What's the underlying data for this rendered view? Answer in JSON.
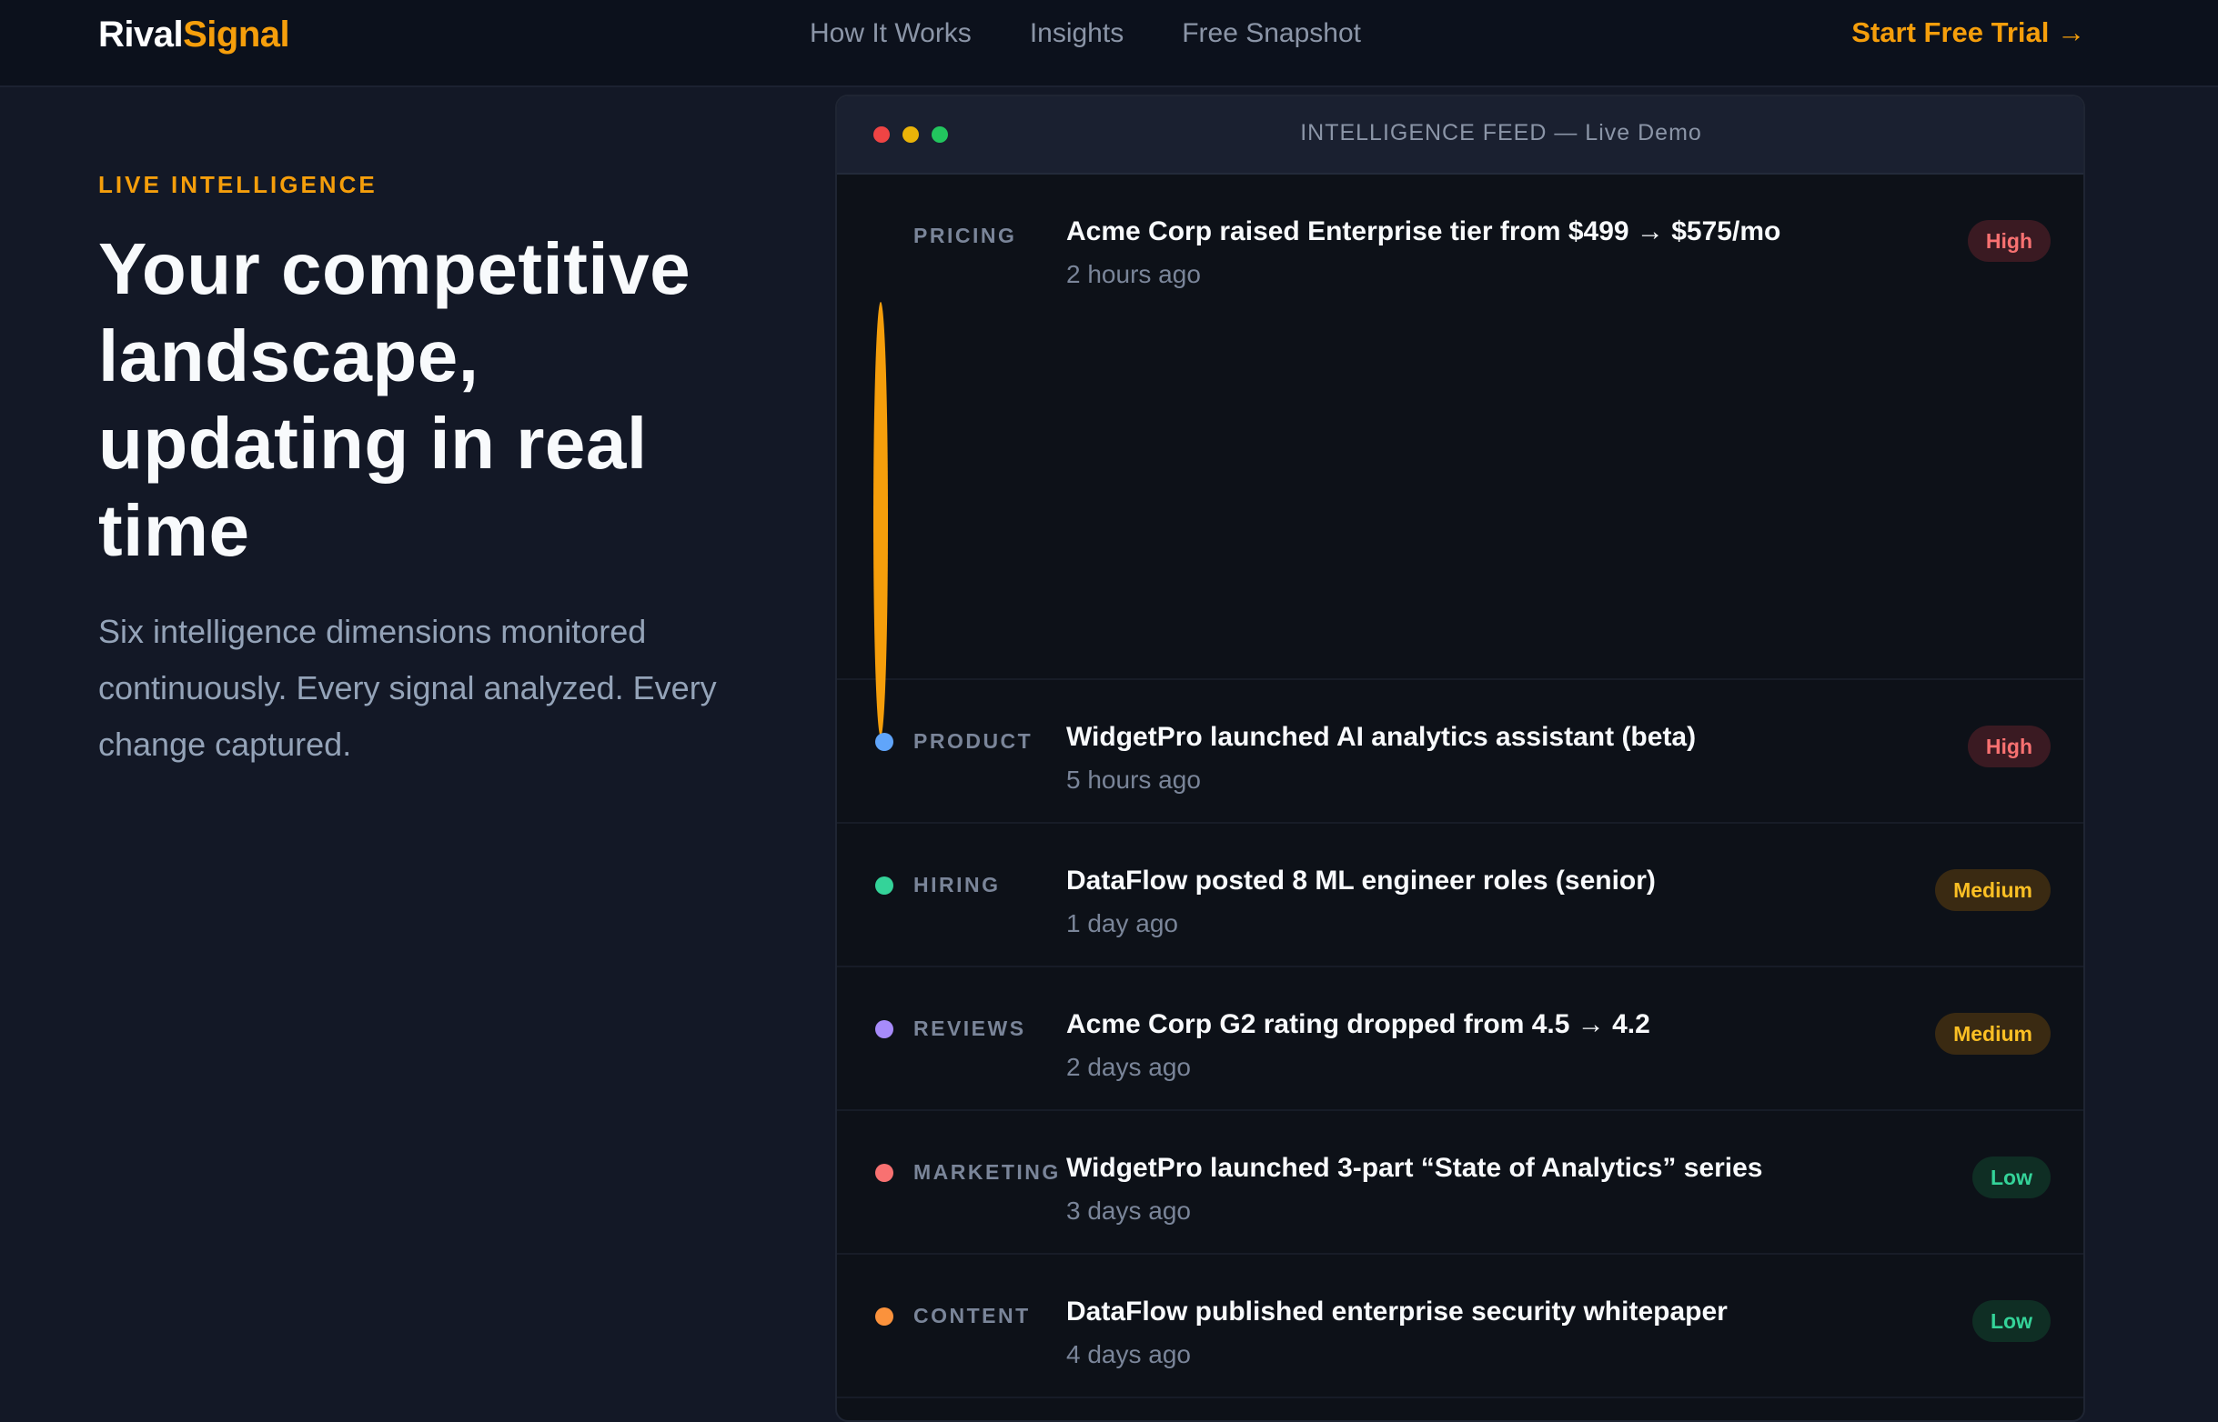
{
  "nav": {
    "logo_a": "Rival",
    "logo_b": "Signal",
    "links": [
      "How It Works",
      "Insights",
      "Free Snapshot"
    ],
    "cta": "Start Free Trial →"
  },
  "hero": {
    "eyebrow": "LIVE INTELLIGENCE",
    "title": "Your competitive landscape, updating in real time",
    "subtitle": "Six intelligence dimensions monitored continuously. Every signal analyzed. Every change captured."
  },
  "feed": {
    "title": "INTELLIGENCE FEED — Live Demo",
    "items": [
      {
        "category": "PRICING",
        "headline": "Acme Corp raised Enterprise tier from $499 → $575/mo",
        "time": "2 hours ago",
        "priority": "High",
        "color": "#f59e0b"
      },
      {
        "category": "PRODUCT",
        "headline": "WidgetPro launched AI analytics assistant (beta)",
        "time": "5 hours ago",
        "priority": "High",
        "color": "#60a5fa"
      },
      {
        "category": "HIRING",
        "headline": "DataFlow posted 8 ML engineer roles (senior)",
        "time": "1 day ago",
        "priority": "Medium",
        "color": "#34d399"
      },
      {
        "category": "REVIEWS",
        "headline": "Acme Corp G2 rating dropped from 4.5 → 4.2",
        "time": "2 days ago",
        "priority": "Medium",
        "color": "#a78bfa"
      },
      {
        "category": "MARKETING",
        "headline": "WidgetPro launched 3-part “State of Analytics” series",
        "time": "3 days ago",
        "priority": "Low",
        "color": "#f87171"
      },
      {
        "category": "CONTENT",
        "headline": "DataFlow published enterprise security whitepaper",
        "time": "4 days ago",
        "priority": "Low",
        "color": "#fb923c"
      }
    ]
  }
}
